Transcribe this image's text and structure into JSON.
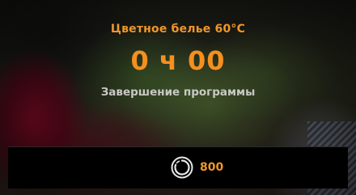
{
  "program": {
    "name": "Цветное белье 60°C",
    "time_remaining": "0 ч 00",
    "status": "Завершение программы"
  },
  "bottom_bar": {
    "spin_icon": "spin-speed-icon",
    "spin_speed": "800"
  },
  "colors": {
    "accent": "#f0962a",
    "status_text": "#c9c9c4",
    "bar_background": "#000000"
  }
}
